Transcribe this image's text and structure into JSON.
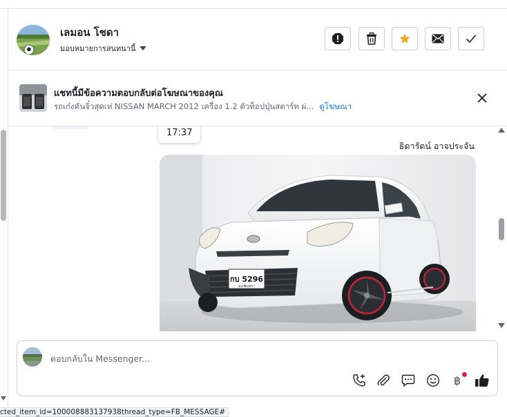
{
  "header": {
    "name": "เลมอน โชดา",
    "assign_label": "มอบหมายการสนทนานี้",
    "actions": {
      "spam": "spam-icon",
      "delete": "trash-icon",
      "star": "star-icon",
      "email": "email-icon",
      "done": "check-icon"
    },
    "star_color": "#f5a623"
  },
  "ad_banner": {
    "title": "แชทนี้มีข้อความตอบกลับต่อโฆษณาของคุณ",
    "subtitle": "รถเก๋งคันจิ๋วสุดเท่ NISSAN MARCH 2012 เครื่อง 1.2 ตัวท็อปปุ่นสตาร์ท ผ่...",
    "link": "ดูโฆษณา"
  },
  "thread": {
    "timestamp": "17:37",
    "sender_name": "ธิดารัตน์ อาจประจัน",
    "photo_plate": "กบ 5296",
    "photo_plate_province": "ฉะเชิงเทรา"
  },
  "composer": {
    "placeholder": "ตอบกลับใน Messenger...",
    "tools": [
      "call-add-icon",
      "attach-icon",
      "saved-replies-icon",
      "emoji-icon",
      "baht-payment-icon",
      "thumbs-up-icon"
    ],
    "baht_symbol": "฿",
    "accent": "#1877f2"
  },
  "status_bar": {
    "url": "cted_item_id=100008883137938thread_type=FB_MESSAGE#"
  }
}
